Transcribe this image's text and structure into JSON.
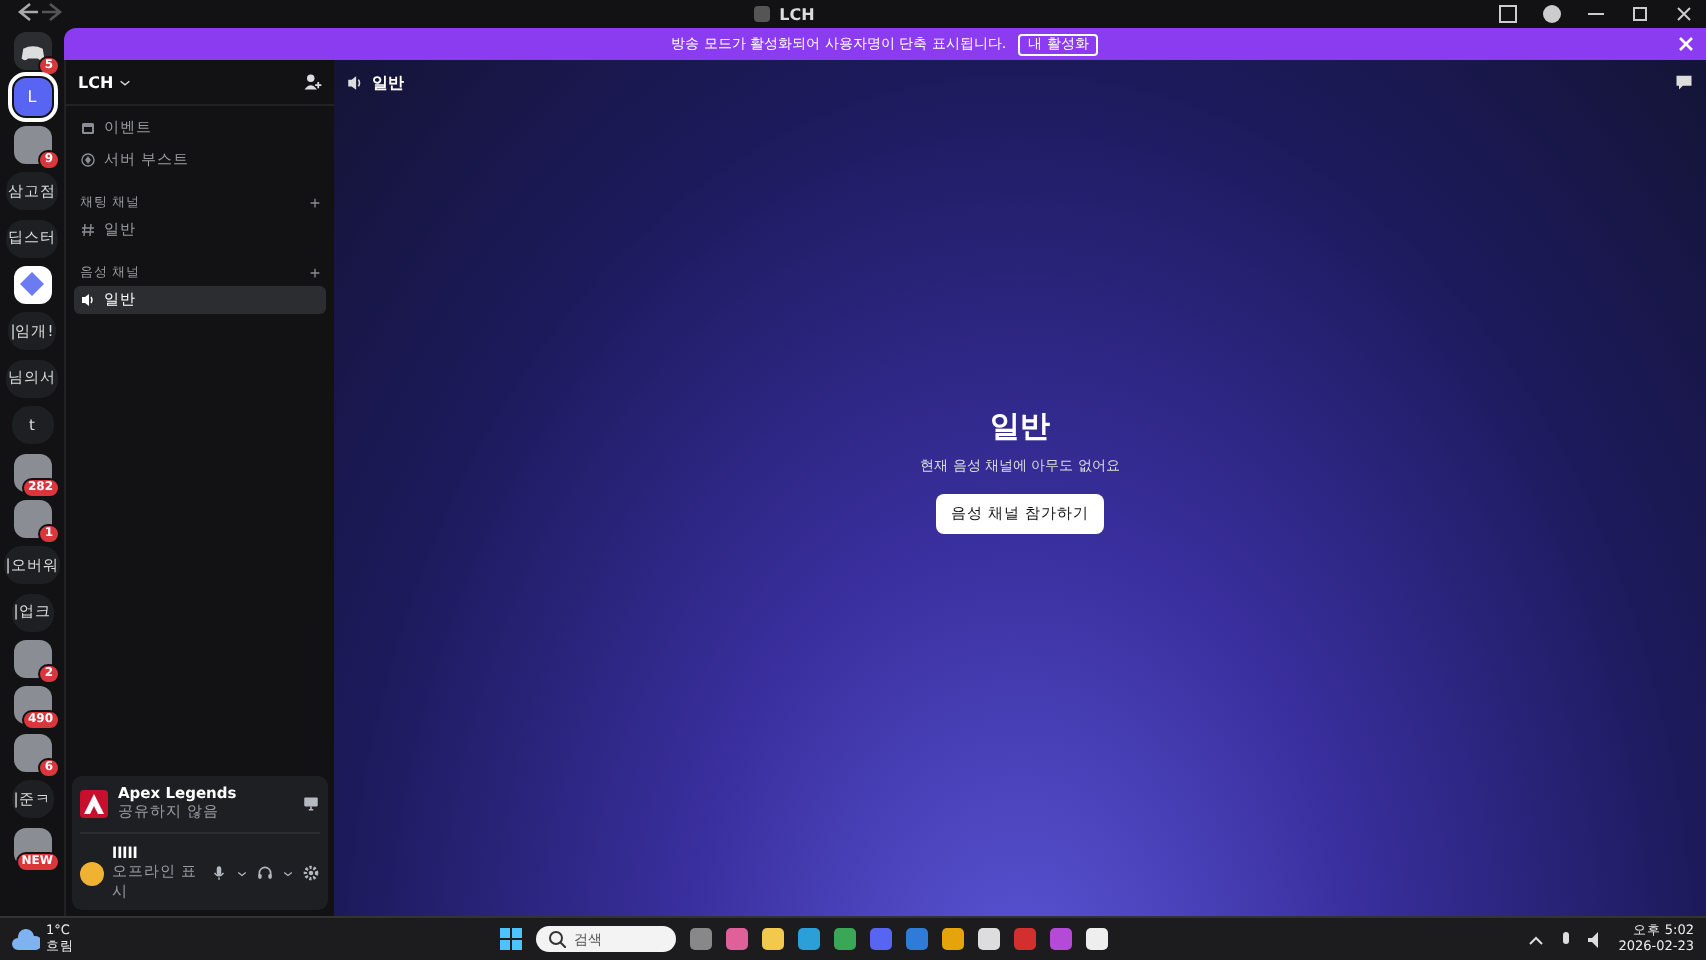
{
  "window": {
    "title": "LCH"
  },
  "banner": {
    "text": "방송 모드가 활성화되어 사용자명이 단축 표시됩니다.",
    "button": "내 활성화"
  },
  "servers": [
    {
      "kind": "logo",
      "badge": "5",
      "selected": false
    },
    {
      "kind": "letter",
      "label": "L",
      "selected": true
    },
    {
      "kind": "photo",
      "badge": "9",
      "selected": false
    },
    {
      "kind": "text",
      "label": "삼고점",
      "selected": false
    },
    {
      "kind": "text",
      "label": "딥스터",
      "selected": false
    },
    {
      "kind": "app",
      "selected": false
    },
    {
      "kind": "text",
      "label": "|임개!",
      "selected": false
    },
    {
      "kind": "text",
      "label": "님의서",
      "selected": false
    },
    {
      "kind": "text",
      "label": "t",
      "selected": false
    },
    {
      "kind": "photo",
      "badge": "282",
      "selected": false
    },
    {
      "kind": "photo",
      "badge": "1",
      "selected": false
    },
    {
      "kind": "text",
      "label": "|오버워",
      "selected": false
    },
    {
      "kind": "text",
      "label": "|업크",
      "selected": false
    },
    {
      "kind": "photo",
      "badge": "2",
      "selected": false
    },
    {
      "kind": "photo",
      "badge": "490",
      "selected": false
    },
    {
      "kind": "photo",
      "badge": "6",
      "selected": false
    },
    {
      "kind": "text",
      "label": "|준ㅋ",
      "selected": false
    },
    {
      "kind": "photo",
      "badge": "NEW",
      "selected": false
    }
  ],
  "server": {
    "name": "LCH"
  },
  "channel_panel": {
    "items": [
      {
        "kind": "event",
        "label": "이벤트"
      },
      {
        "kind": "boost",
        "label": "서버 부스트"
      }
    ],
    "categories": [
      {
        "label": "채팅 채널",
        "channels": [
          {
            "kind": "text",
            "label": "일반",
            "selected": false
          }
        ]
      },
      {
        "label": "음성 채널",
        "channels": [
          {
            "kind": "voice",
            "label": "일반",
            "selected": true
          }
        ]
      }
    ]
  },
  "activity": {
    "game": "Apex Legends",
    "status": "공유하지 않음"
  },
  "user": {
    "name": "lllll",
    "status": "오프라인 표시"
  },
  "header": {
    "channel": "일반"
  },
  "stage": {
    "title": "일반",
    "subtitle": "현재 음성 채널에 아무도 없어요",
    "button": "음성 채널 참가하기"
  },
  "taskbar": {
    "weather_temp": "1°C",
    "weather_text": "흐림",
    "search_placeholder": "검색",
    "time": "오후 5:02",
    "date": "2026-02-23"
  }
}
